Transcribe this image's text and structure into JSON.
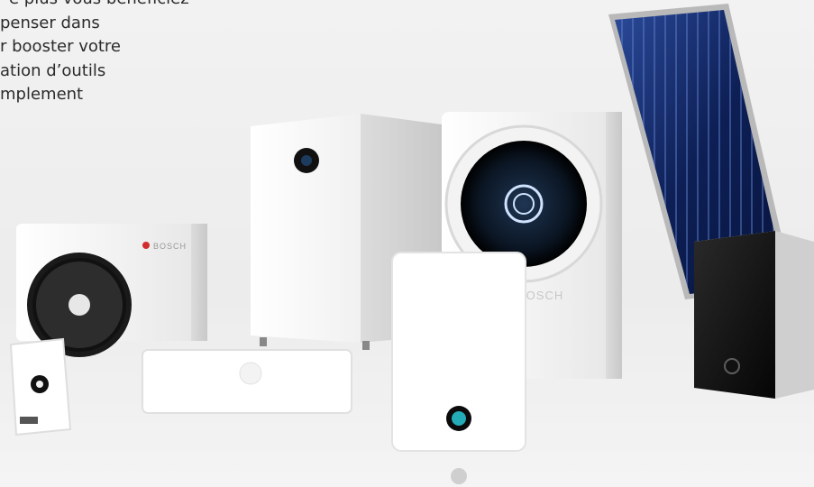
{
  "intro_text": {
    "lines": [
      "e plus vous bénéficiez",
      "penser dans",
      "r booster votre",
      "ation d’outils",
      "mplement"
    ]
  },
  "brand": {
    "outdoor_unit_logo": "BOSCH",
    "heat_pump_logo": "BOSCH"
  },
  "colors": {
    "background": "#efefef",
    "panel_blue": "#0f2a6a",
    "display_teal": "#28c9d6",
    "accent_red": "#d12d2d"
  }
}
